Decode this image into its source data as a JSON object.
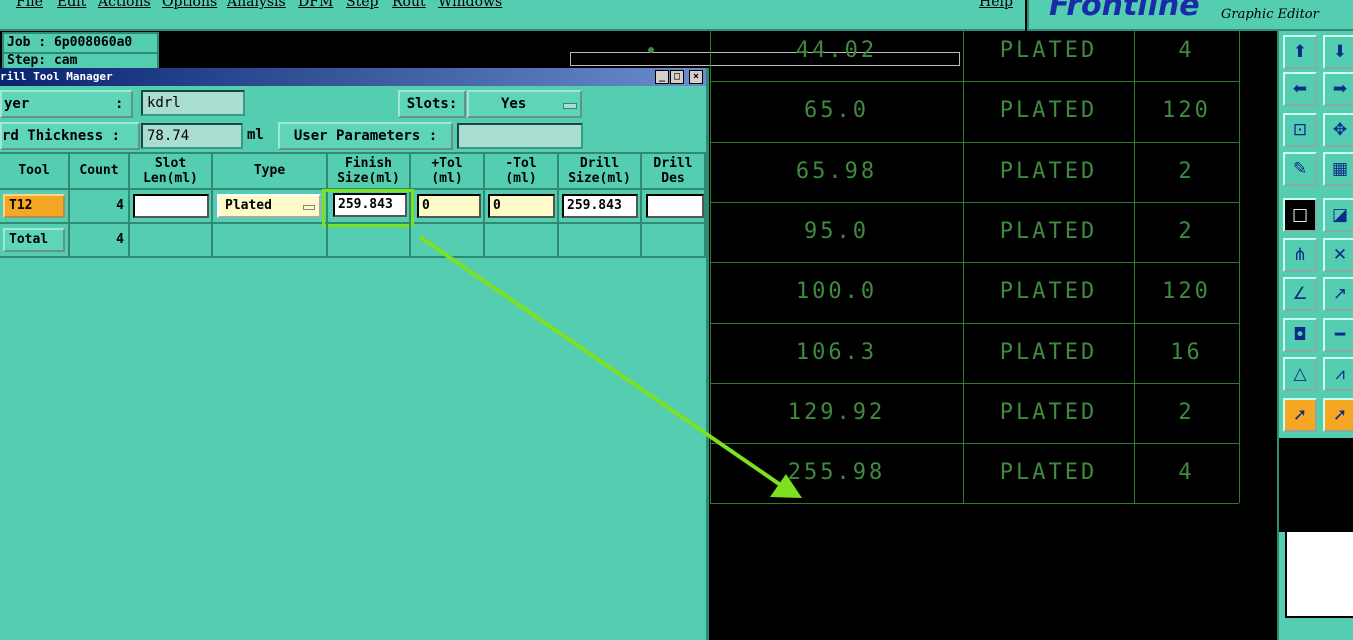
{
  "menu": {
    "items": [
      "File",
      "Edit",
      "Actions",
      "Options",
      "Analysis",
      "DFM",
      "Step",
      "Rout",
      "Windows"
    ],
    "help": "Help"
  },
  "logo": {
    "name": "Frontline",
    "subtitle": "Graphic Editor"
  },
  "job": {
    "job_label": "Job : 6p008060a0",
    "step_label": "Step: cam"
  },
  "window": {
    "title": "rill Tool Manager",
    "layer_label": "yer",
    "layer_sep": ":",
    "layer_value": "kdrl",
    "slots_label": "Slots:",
    "slots_value": "Yes",
    "thickness_label": "rd Thickness :",
    "thickness_value": "78.74",
    "thickness_unit": "ml",
    "user_params_label": "User Parameters :",
    "user_params_value": ""
  },
  "table": {
    "headers": [
      "Tool",
      "Count",
      "Slot\nLen(ml)",
      "Type",
      "Finish\nSize(ml)",
      "+Tol\n(ml)",
      "-Tol\n(ml)",
      "Drill\nSize(ml)",
      "Drill\nDes"
    ],
    "rows": [
      {
        "tool": "T12",
        "count": "4",
        "slot_len": "",
        "type": "Plated",
        "finish": "259.843",
        "ptol": "0",
        "mtol": "0",
        "drill": "259.843",
        "des": ""
      },
      {
        "tool": "Total",
        "count": "4"
      }
    ]
  },
  "drill_table": [
    {
      "size": "44.02",
      "type": "PLATED",
      "qty": "4"
    },
    {
      "size": "65.0",
      "type": "PLATED",
      "qty": "120"
    },
    {
      "size": "65.98",
      "type": "PLATED",
      "qty": "2"
    },
    {
      "size": "95.0",
      "type": "PLATED",
      "qty": "2"
    },
    {
      "size": "100.0",
      "type": "PLATED",
      "qty": "120"
    },
    {
      "size": "106.3",
      "type": "PLATED",
      "qty": "16"
    },
    {
      "size": "129.92",
      "type": "PLATED",
      "qty": "2"
    },
    {
      "size": "255.98",
      "type": "PLATED",
      "qty": "4"
    }
  ],
  "colors": {
    "panel": "#55cdb0",
    "grid": "#2e7a2e",
    "text_green": "#3f8a3f",
    "highlight": "#7ee022",
    "selected": "#f5a623"
  },
  "toolbar": {
    "icons": [
      "zoom-home-icon",
      "zoom-down-icon",
      "zoom-left-icon",
      "zoom-right-icon",
      "zoom-fit-icon",
      "pan-icon",
      "measure-icon",
      "grid-icon",
      "snap-pad-icon",
      "add-pad-icon",
      "connect-icon",
      "delete-node-icon",
      "line-icon",
      "line-arrow-icon",
      "add-via-icon",
      "cut-line-icon",
      "triangle-icon",
      "triangle-split-icon",
      "select-arrow-icon",
      "select-arrow-alt-icon"
    ]
  }
}
